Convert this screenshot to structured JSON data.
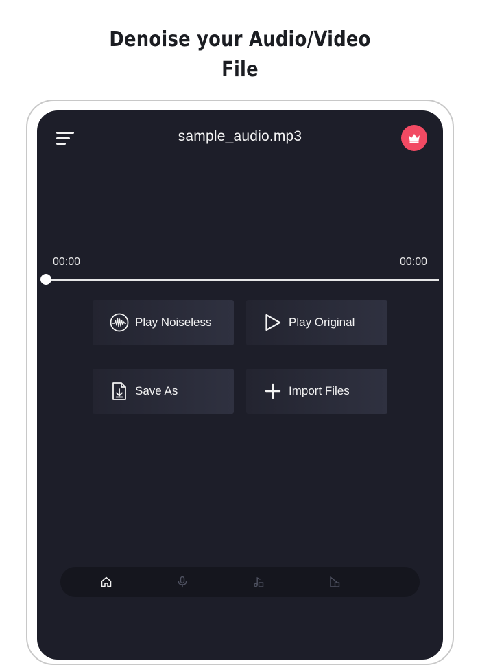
{
  "headline": {
    "line1": "Denoise your Audio/Video",
    "line2": "File"
  },
  "header": {
    "menu_icon": "menu-lines-icon",
    "title": "sample_audio.mp3",
    "premium_icon": "crown-icon"
  },
  "player": {
    "time_current": "00:00",
    "time_total": "00:00",
    "progress": 0
  },
  "actions": [
    {
      "label": "Play Noiseless",
      "icon": "waveform-circle-icon"
    },
    {
      "label": "Play Original",
      "icon": "play-icon"
    },
    {
      "label": "Save As",
      "icon": "file-download-icon"
    },
    {
      "label": "Import Files",
      "icon": "plus-icon"
    }
  ],
  "bottom_nav": [
    {
      "icon": "home-icon",
      "active": true
    },
    {
      "icon": "microphone-icon",
      "active": false
    },
    {
      "icon": "music-file-icon",
      "active": false
    },
    {
      "icon": "video-file-icon",
      "active": false
    }
  ],
  "colors": {
    "screen_bg": "#1d1e29",
    "accent": "#f24a63",
    "button_bg": "#2a2b38",
    "nav_bg": "#15161e"
  }
}
